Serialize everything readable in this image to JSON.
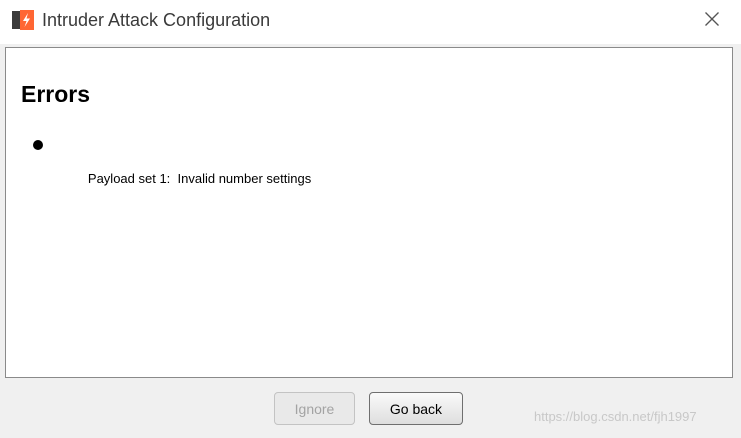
{
  "window": {
    "title": "Intruder Attack Configuration",
    "app_icon": "burp-suite-icon",
    "close_icon": "close-icon"
  },
  "content": {
    "heading": "Errors",
    "errors": [
      {
        "text": "Payload set 1:  Invalid number settings"
      }
    ]
  },
  "buttons": {
    "ignore": {
      "label": "Ignore",
      "enabled": false
    },
    "go_back": {
      "label": "Go back",
      "enabled": true
    }
  },
  "watermark": "https://blog.csdn.net/fjh1997",
  "colors": {
    "icon_orange": "#ff6633",
    "icon_dark": "#3b3b3b",
    "title_text": "#3a3a3a",
    "disabled_text": "#a3a3a3"
  }
}
